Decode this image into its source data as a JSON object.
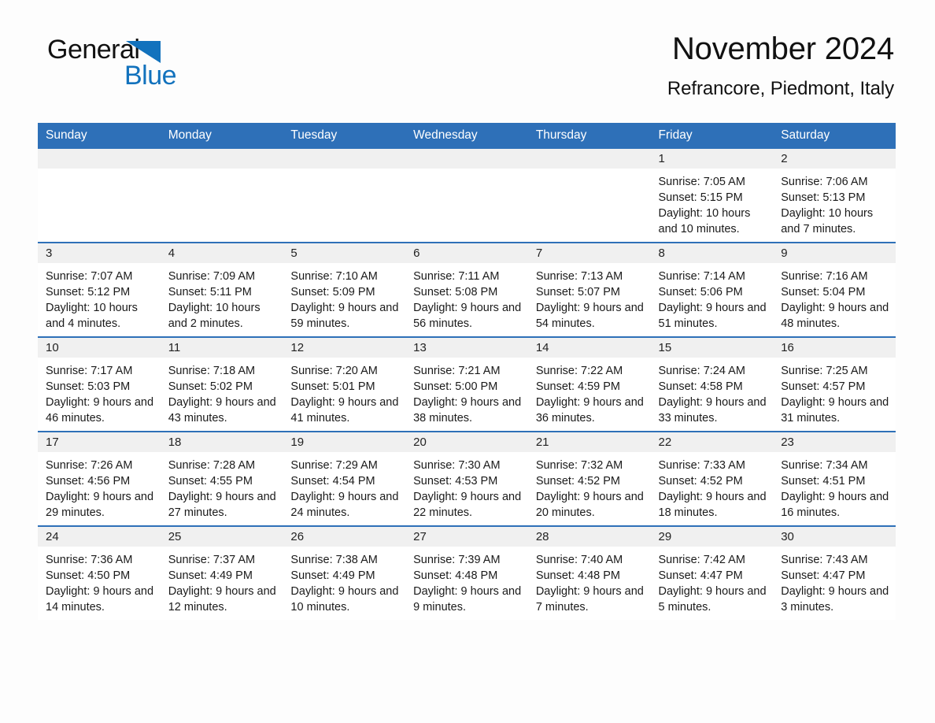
{
  "brand": {
    "name_part1": "General",
    "name_part2": "Blue",
    "triangle_color": "#1272bd",
    "text_color": "#111111"
  },
  "header": {
    "title": "November 2024",
    "location": "Refrancore, Piedmont, Italy"
  },
  "theme": {
    "header_blue": "#2e70b8",
    "daynum_band": "#f0f0f0",
    "page_background": "#fdfdfd",
    "text": "#1a1a1a"
  },
  "weekday_headers": [
    "Sunday",
    "Monday",
    "Tuesday",
    "Wednesday",
    "Thursday",
    "Friday",
    "Saturday"
  ],
  "weeks": [
    [
      {
        "day": "",
        "blank": true,
        "sunrise": "",
        "sunset": "",
        "daylight": ""
      },
      {
        "day": "",
        "blank": true,
        "sunrise": "",
        "sunset": "",
        "daylight": ""
      },
      {
        "day": "",
        "blank": true,
        "sunrise": "",
        "sunset": "",
        "daylight": ""
      },
      {
        "day": "",
        "blank": true,
        "sunrise": "",
        "sunset": "",
        "daylight": ""
      },
      {
        "day": "",
        "blank": true,
        "sunrise": "",
        "sunset": "",
        "daylight": ""
      },
      {
        "day": "1",
        "blank": false,
        "sunrise": "Sunrise: 7:05 AM",
        "sunset": "Sunset: 5:15 PM",
        "daylight": "Daylight: 10 hours and 10 minutes."
      },
      {
        "day": "2",
        "blank": false,
        "sunrise": "Sunrise: 7:06 AM",
        "sunset": "Sunset: 5:13 PM",
        "daylight": "Daylight: 10 hours and 7 minutes."
      }
    ],
    [
      {
        "day": "3",
        "blank": false,
        "sunrise": "Sunrise: 7:07 AM",
        "sunset": "Sunset: 5:12 PM",
        "daylight": "Daylight: 10 hours and 4 minutes."
      },
      {
        "day": "4",
        "blank": false,
        "sunrise": "Sunrise: 7:09 AM",
        "sunset": "Sunset: 5:11 PM",
        "daylight": "Daylight: 10 hours and 2 minutes."
      },
      {
        "day": "5",
        "blank": false,
        "sunrise": "Sunrise: 7:10 AM",
        "sunset": "Sunset: 5:09 PM",
        "daylight": "Daylight: 9 hours and 59 minutes."
      },
      {
        "day": "6",
        "blank": false,
        "sunrise": "Sunrise: 7:11 AM",
        "sunset": "Sunset: 5:08 PM",
        "daylight": "Daylight: 9 hours and 56 minutes."
      },
      {
        "day": "7",
        "blank": false,
        "sunrise": "Sunrise: 7:13 AM",
        "sunset": "Sunset: 5:07 PM",
        "daylight": "Daylight: 9 hours and 54 minutes."
      },
      {
        "day": "8",
        "blank": false,
        "sunrise": "Sunrise: 7:14 AM",
        "sunset": "Sunset: 5:06 PM",
        "daylight": "Daylight: 9 hours and 51 minutes."
      },
      {
        "day": "9",
        "blank": false,
        "sunrise": "Sunrise: 7:16 AM",
        "sunset": "Sunset: 5:04 PM",
        "daylight": "Daylight: 9 hours and 48 minutes."
      }
    ],
    [
      {
        "day": "10",
        "blank": false,
        "sunrise": "Sunrise: 7:17 AM",
        "sunset": "Sunset: 5:03 PM",
        "daylight": "Daylight: 9 hours and 46 minutes."
      },
      {
        "day": "11",
        "blank": false,
        "sunrise": "Sunrise: 7:18 AM",
        "sunset": "Sunset: 5:02 PM",
        "daylight": "Daylight: 9 hours and 43 minutes."
      },
      {
        "day": "12",
        "blank": false,
        "sunrise": "Sunrise: 7:20 AM",
        "sunset": "Sunset: 5:01 PM",
        "daylight": "Daylight: 9 hours and 41 minutes."
      },
      {
        "day": "13",
        "blank": false,
        "sunrise": "Sunrise: 7:21 AM",
        "sunset": "Sunset: 5:00 PM",
        "daylight": "Daylight: 9 hours and 38 minutes."
      },
      {
        "day": "14",
        "blank": false,
        "sunrise": "Sunrise: 7:22 AM",
        "sunset": "Sunset: 4:59 PM",
        "daylight": "Daylight: 9 hours and 36 minutes."
      },
      {
        "day": "15",
        "blank": false,
        "sunrise": "Sunrise: 7:24 AM",
        "sunset": "Sunset: 4:58 PM",
        "daylight": "Daylight: 9 hours and 33 minutes."
      },
      {
        "day": "16",
        "blank": false,
        "sunrise": "Sunrise: 7:25 AM",
        "sunset": "Sunset: 4:57 PM",
        "daylight": "Daylight: 9 hours and 31 minutes."
      }
    ],
    [
      {
        "day": "17",
        "blank": false,
        "sunrise": "Sunrise: 7:26 AM",
        "sunset": "Sunset: 4:56 PM",
        "daylight": "Daylight: 9 hours and 29 minutes."
      },
      {
        "day": "18",
        "blank": false,
        "sunrise": "Sunrise: 7:28 AM",
        "sunset": "Sunset: 4:55 PM",
        "daylight": "Daylight: 9 hours and 27 minutes."
      },
      {
        "day": "19",
        "blank": false,
        "sunrise": "Sunrise: 7:29 AM",
        "sunset": "Sunset: 4:54 PM",
        "daylight": "Daylight: 9 hours and 24 minutes."
      },
      {
        "day": "20",
        "blank": false,
        "sunrise": "Sunrise: 7:30 AM",
        "sunset": "Sunset: 4:53 PM",
        "daylight": "Daylight: 9 hours and 22 minutes."
      },
      {
        "day": "21",
        "blank": false,
        "sunrise": "Sunrise: 7:32 AM",
        "sunset": "Sunset: 4:52 PM",
        "daylight": "Daylight: 9 hours and 20 minutes."
      },
      {
        "day": "22",
        "blank": false,
        "sunrise": "Sunrise: 7:33 AM",
        "sunset": "Sunset: 4:52 PM",
        "daylight": "Daylight: 9 hours and 18 minutes."
      },
      {
        "day": "23",
        "blank": false,
        "sunrise": "Sunrise: 7:34 AM",
        "sunset": "Sunset: 4:51 PM",
        "daylight": "Daylight: 9 hours and 16 minutes."
      }
    ],
    [
      {
        "day": "24",
        "blank": false,
        "sunrise": "Sunrise: 7:36 AM",
        "sunset": "Sunset: 4:50 PM",
        "daylight": "Daylight: 9 hours and 14 minutes."
      },
      {
        "day": "25",
        "blank": false,
        "sunrise": "Sunrise: 7:37 AM",
        "sunset": "Sunset: 4:49 PM",
        "daylight": "Daylight: 9 hours and 12 minutes."
      },
      {
        "day": "26",
        "blank": false,
        "sunrise": "Sunrise: 7:38 AM",
        "sunset": "Sunset: 4:49 PM",
        "daylight": "Daylight: 9 hours and 10 minutes."
      },
      {
        "day": "27",
        "blank": false,
        "sunrise": "Sunrise: 7:39 AM",
        "sunset": "Sunset: 4:48 PM",
        "daylight": "Daylight: 9 hours and 9 minutes."
      },
      {
        "day": "28",
        "blank": false,
        "sunrise": "Sunrise: 7:40 AM",
        "sunset": "Sunset: 4:48 PM",
        "daylight": "Daylight: 9 hours and 7 minutes."
      },
      {
        "day": "29",
        "blank": false,
        "sunrise": "Sunrise: 7:42 AM",
        "sunset": "Sunset: 4:47 PM",
        "daylight": "Daylight: 9 hours and 5 minutes."
      },
      {
        "day": "30",
        "blank": false,
        "sunrise": "Sunrise: 7:43 AM",
        "sunset": "Sunset: 4:47 PM",
        "daylight": "Daylight: 9 hours and 3 minutes."
      }
    ]
  ]
}
